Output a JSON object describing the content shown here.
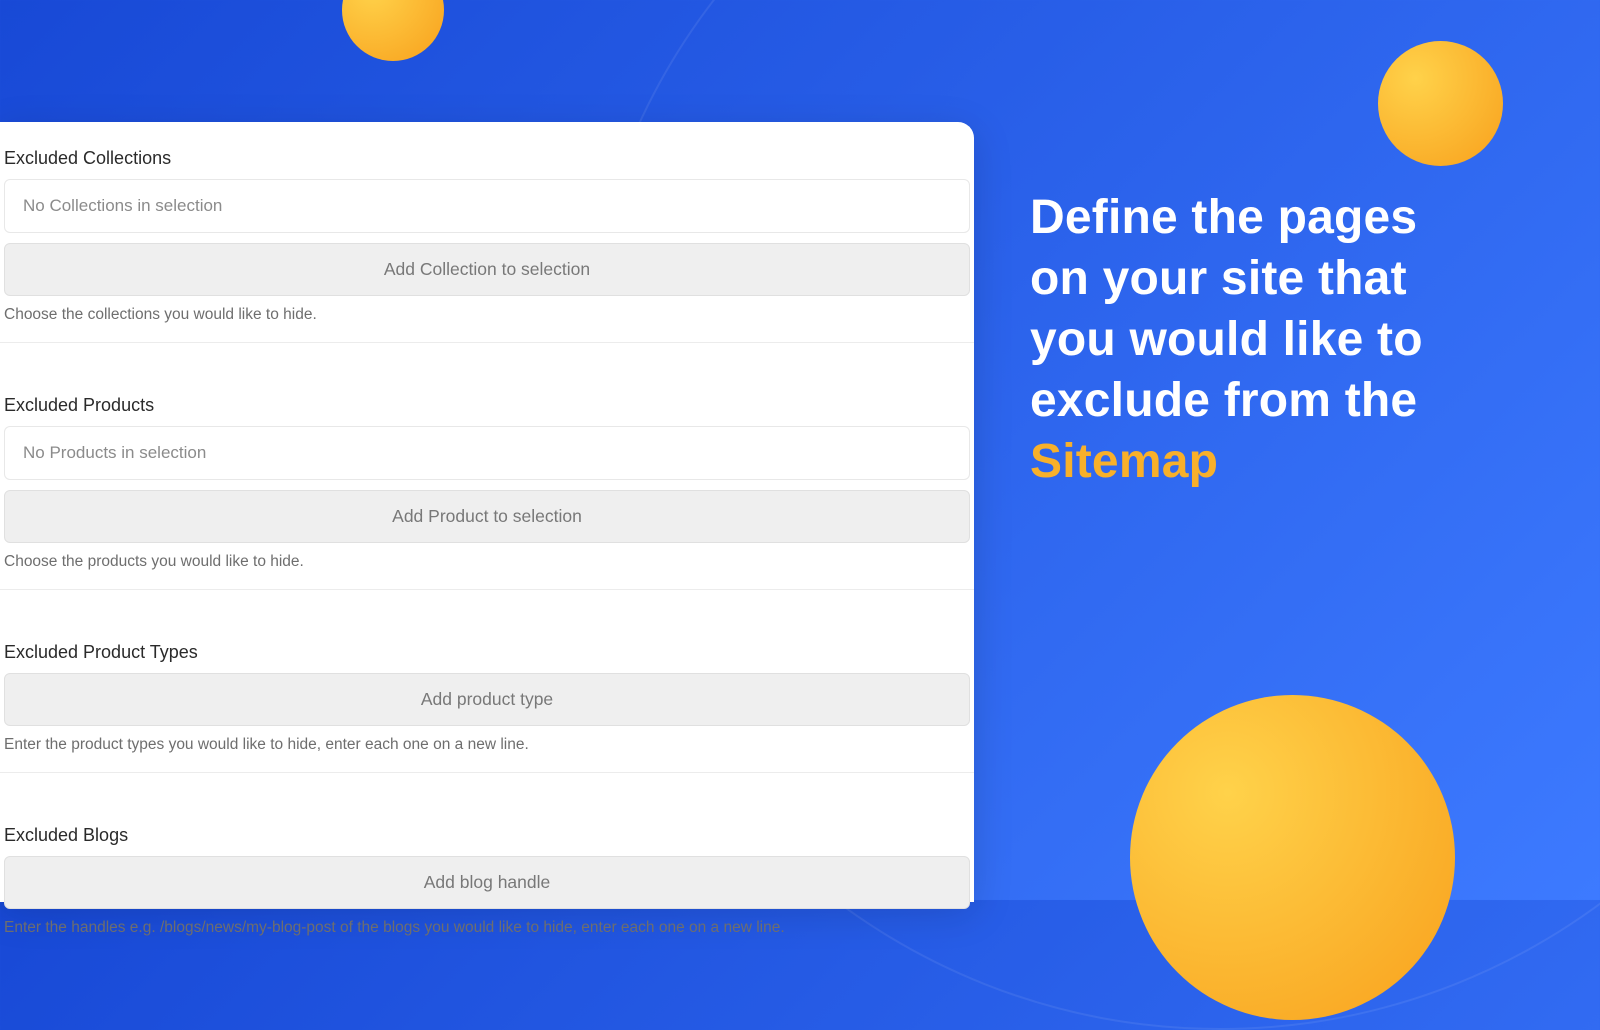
{
  "headline": {
    "line1": "Define the pages",
    "line2": "on your site that",
    "line3": "you would like to",
    "line4": "exclude from the",
    "accent": "Sitemap"
  },
  "sections": {
    "collections": {
      "title": "Excluded Collections",
      "empty": "No Collections in selection",
      "button": "Add Collection to selection",
      "help": "Choose the collections you would like to hide."
    },
    "products": {
      "title": "Excluded Products",
      "empty": "No Products in selection",
      "button": "Add Product to selection",
      "help": "Choose the products you would like to hide."
    },
    "productTypes": {
      "title": "Excluded Product Types",
      "button": "Add product type",
      "help": "Enter the product types you would like to hide, enter each one on a new line."
    },
    "blogs": {
      "title": "Excluded Blogs",
      "button": "Add blog handle",
      "help": "Enter the handles e.g. /blogs/news/my-blog-post of the blogs you would like to hide, enter each one on a new line."
    }
  }
}
